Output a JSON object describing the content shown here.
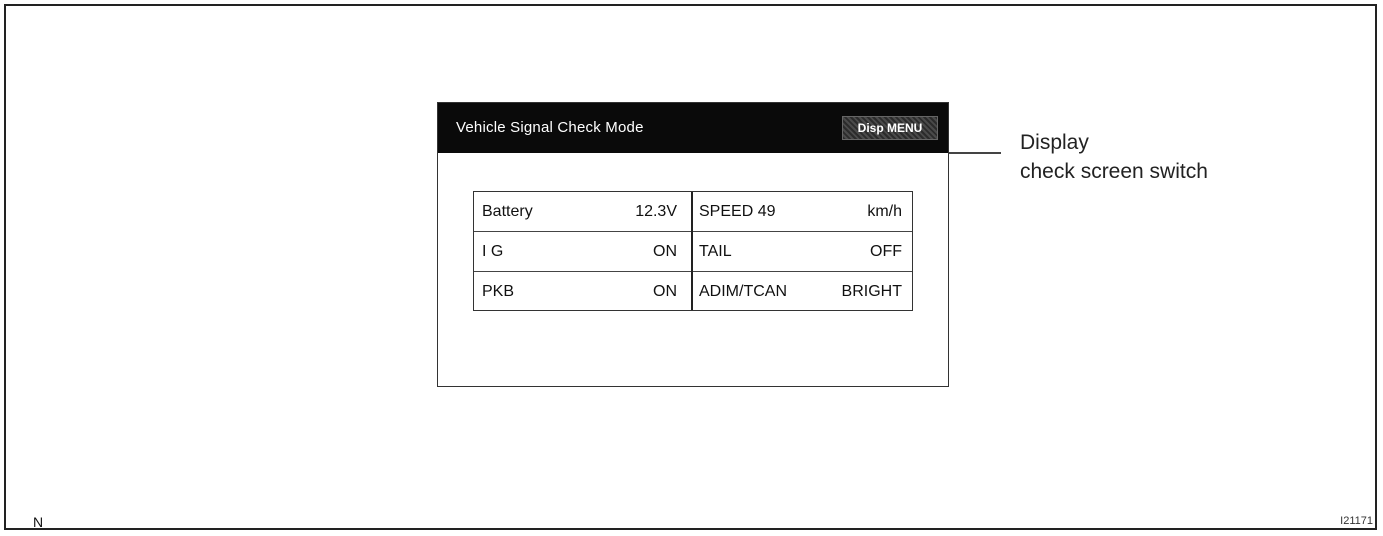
{
  "screen": {
    "title": "Vehicle  Signal Check  Mode",
    "disp_menu_button": "Disp MENU",
    "signals_left": [
      {
        "label": "Battery",
        "value": "12.3V"
      },
      {
        "label": "I G",
        "value": "ON"
      },
      {
        "label": "PKB",
        "value": "ON"
      }
    ],
    "signals_right": [
      {
        "label": "SPEED  49",
        "value": "km/h"
      },
      {
        "label": "TAIL",
        "value": "OFF"
      },
      {
        "label": "ADIM/TCAN",
        "value": "BRIGHT"
      }
    ]
  },
  "callout": {
    "line1": "Display",
    "line2": "check screen switch"
  },
  "corner": {
    "left": "N",
    "right": "I21171"
  }
}
